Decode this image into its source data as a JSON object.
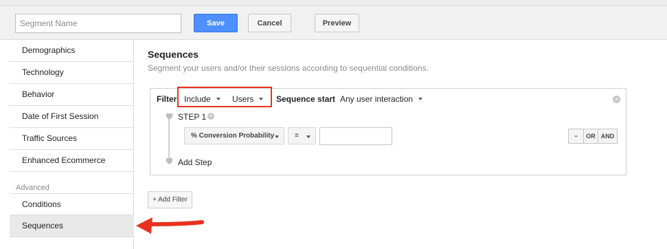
{
  "toolbar": {
    "segment_name_placeholder": "Segment Name",
    "save_label": "Save",
    "cancel_label": "Cancel",
    "preview_label": "Preview"
  },
  "sidebar": {
    "items": [
      {
        "label": "Demographics"
      },
      {
        "label": "Technology"
      },
      {
        "label": "Behavior"
      },
      {
        "label": "Date of First Session"
      },
      {
        "label": "Traffic Sources"
      },
      {
        "label": "Enhanced Ecommerce"
      }
    ],
    "advanced_heading": "Advanced",
    "advanced_items": [
      {
        "label": "Conditions"
      },
      {
        "label": "Sequences",
        "active": true
      }
    ]
  },
  "main": {
    "title": "Sequences",
    "subtitle": "Segment your users and/or their sessions according to sequential conditions.",
    "filter": {
      "label": "Filter",
      "include_value": "Include",
      "scope_value": "Users",
      "sequence_start_label": "Sequence start",
      "sequence_start_value": "Any user interaction",
      "close_glyph": "×"
    },
    "step": {
      "label": "STEP 1",
      "remove_glyph": "×",
      "dimension_value": "% Conversion Probability",
      "operator_value": "=",
      "value": "",
      "minus_label": "−",
      "or_label": "OR",
      "and_label": "AND"
    },
    "add_step_label": "Add Step",
    "add_filter_label": "+ Add Filter"
  },
  "colors": {
    "primary_button": "#4d90fe",
    "highlight_box": "#e8321f",
    "annotation_arrow": "#e8321f"
  }
}
